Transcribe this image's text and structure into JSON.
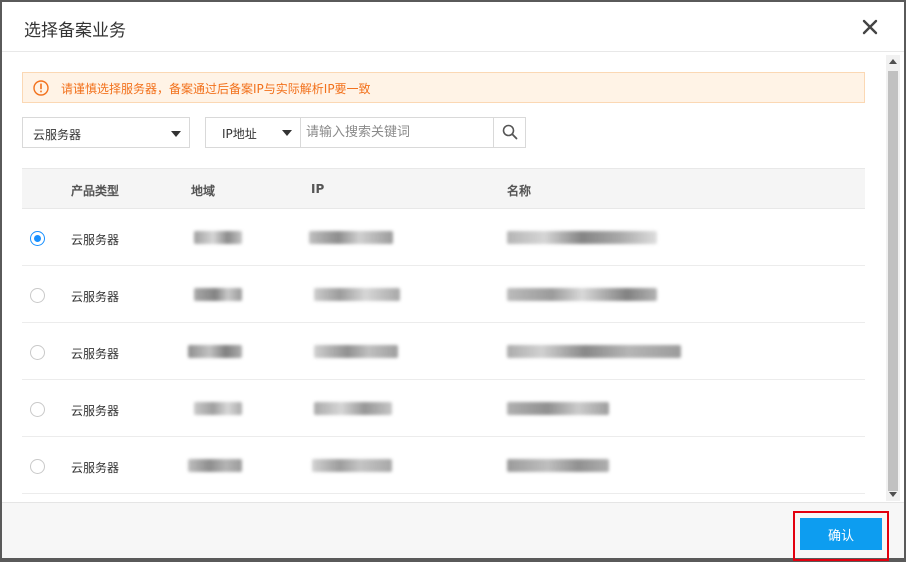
{
  "dialog": {
    "title": "选择备案业务"
  },
  "notice": {
    "text": "请谨慎选择服务器，备案通过后备案IP与实际解析IP要一致"
  },
  "filters": {
    "product_select": "云服务器",
    "field_select": "IP地址",
    "search_placeholder": "请输入搜索关键词"
  },
  "table": {
    "headers": {
      "type": "产品类型",
      "region": "地域",
      "ip": "IP",
      "name": "名称"
    },
    "rows": [
      {
        "type": "云服务器",
        "selected": true
      },
      {
        "type": "云服务器",
        "selected": false
      },
      {
        "type": "云服务器",
        "selected": false
      },
      {
        "type": "云服务器",
        "selected": false
      },
      {
        "type": "云服务器",
        "selected": false
      }
    ]
  },
  "footer": {
    "confirm_label": "确认"
  },
  "colors": {
    "accent": "#1890ff",
    "notice_text": "#f2711c",
    "confirm_bg": "#0d9df0",
    "highlight": "#e3000f"
  },
  "icons": [
    "close-icon",
    "warning-icon",
    "caret-down-icon",
    "search-icon"
  ]
}
